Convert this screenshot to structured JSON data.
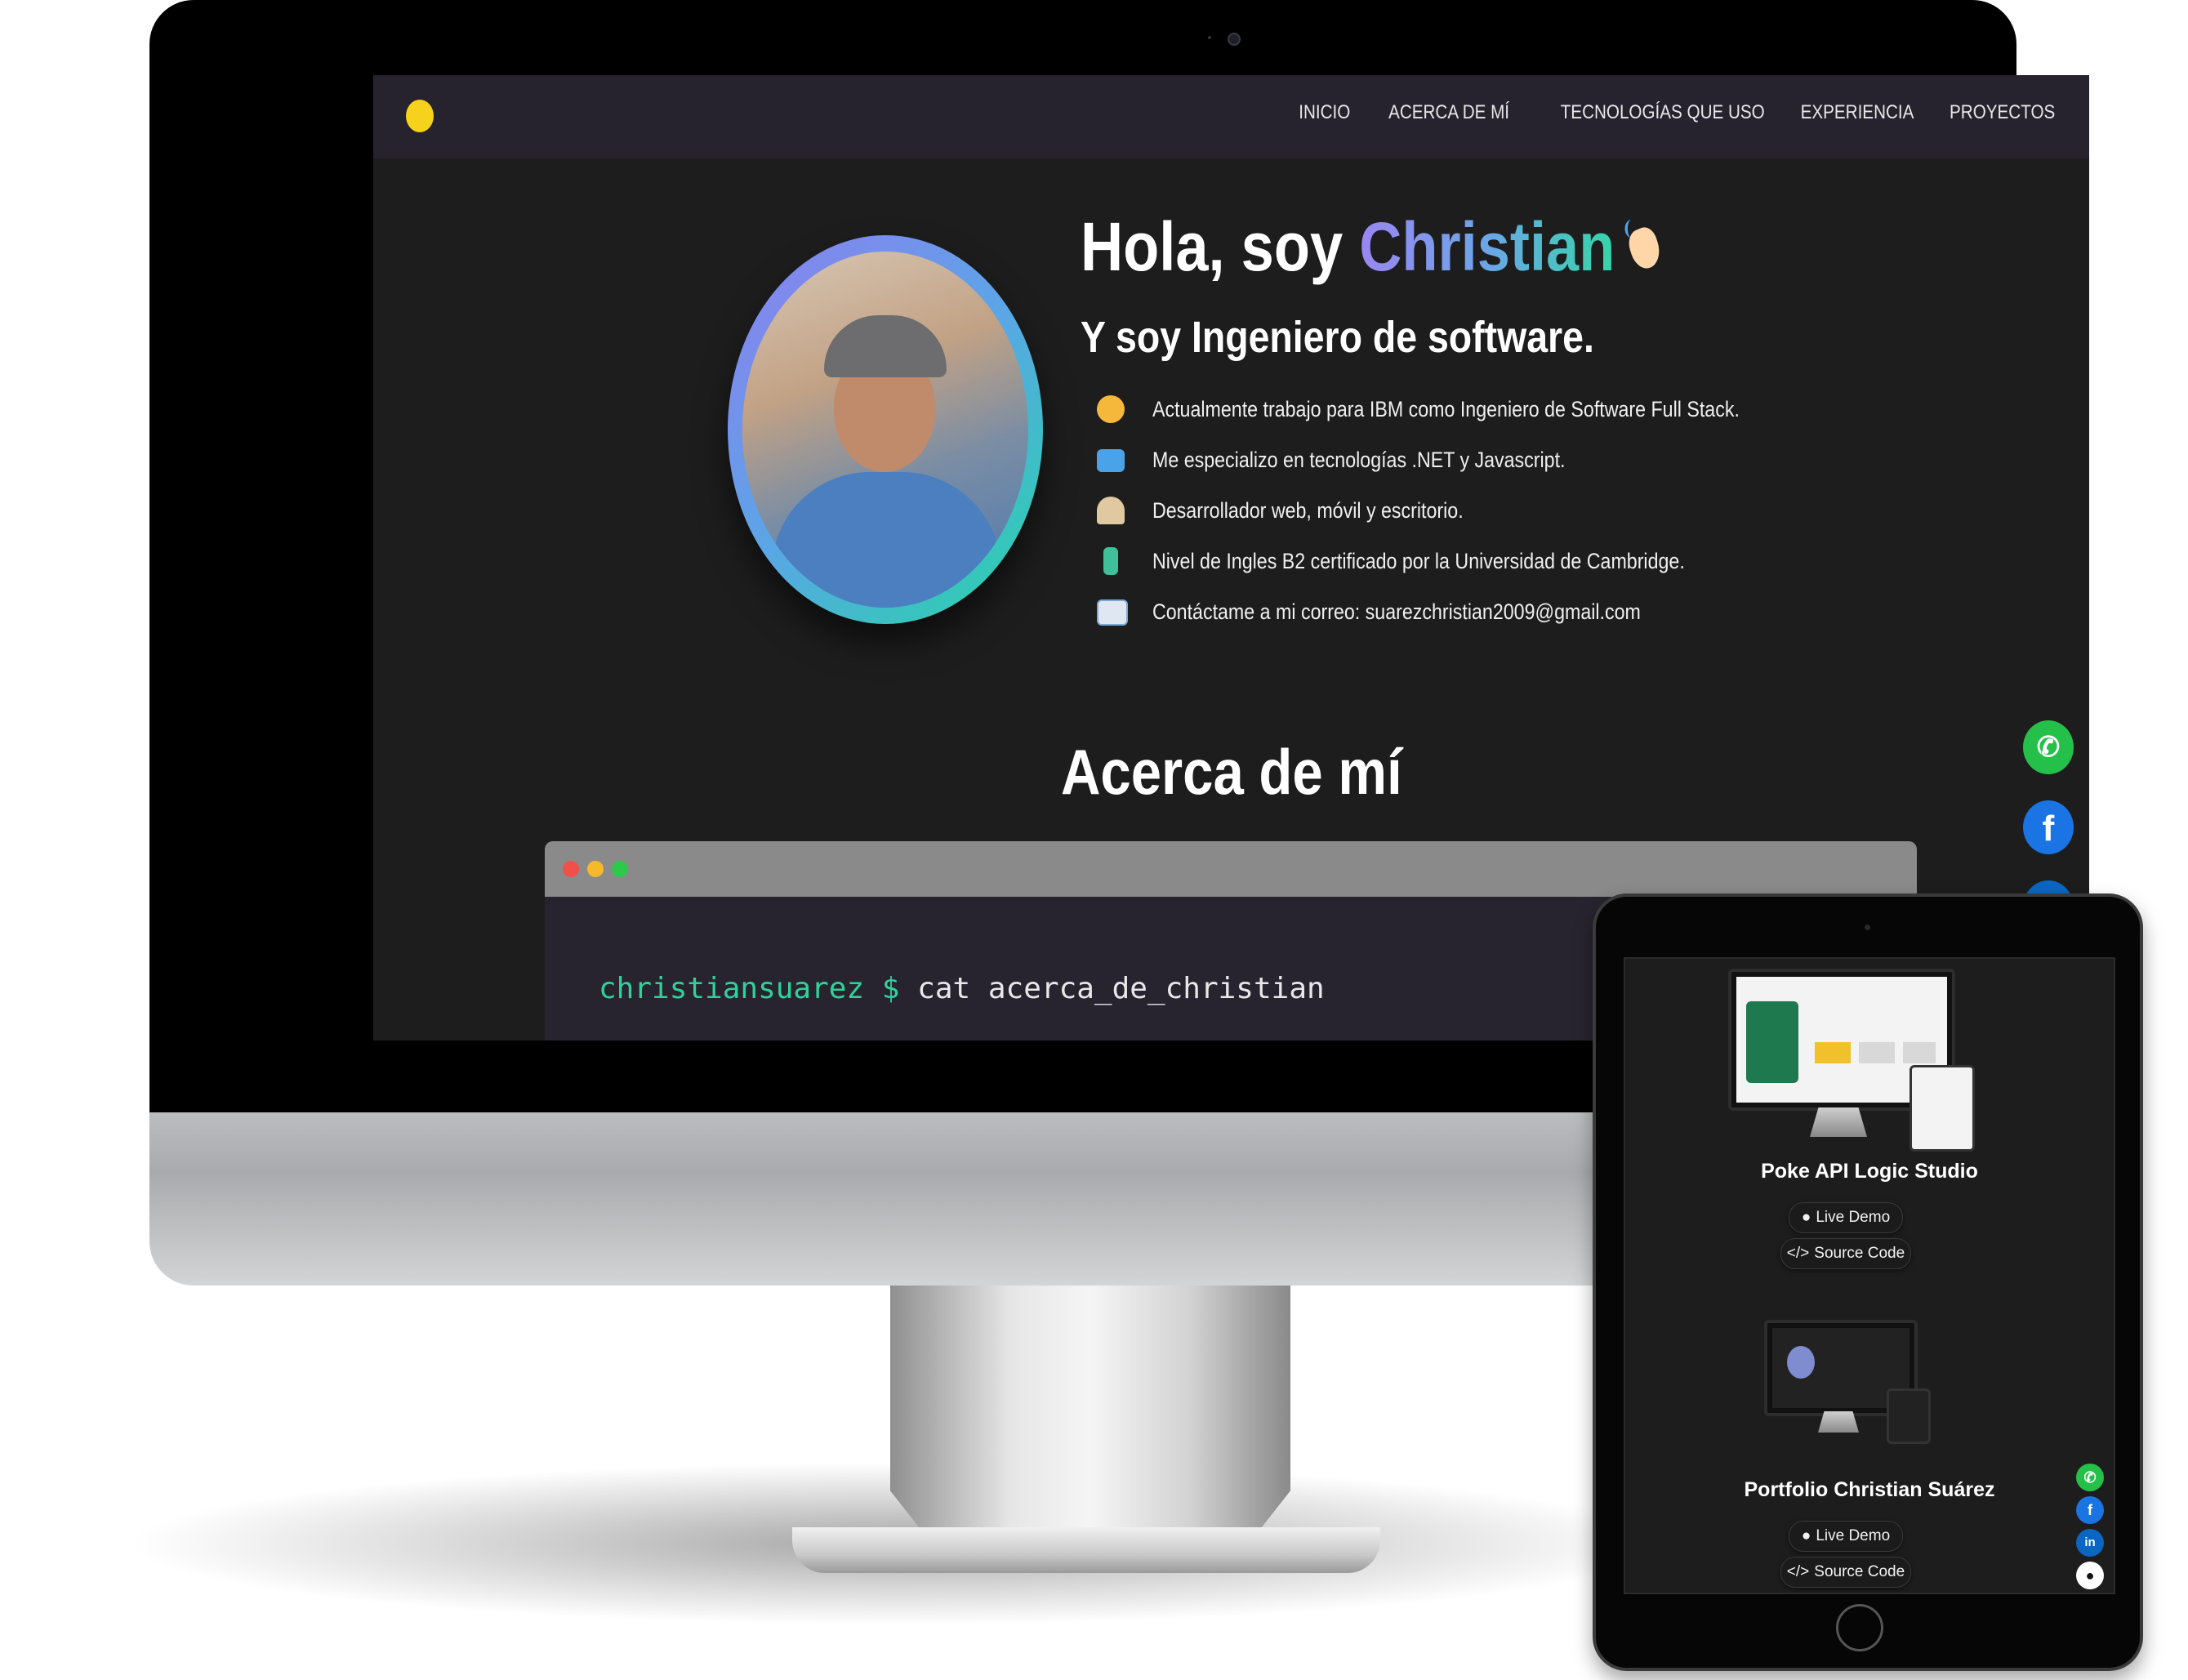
{
  "desktop": {
    "nav": {
      "links": [
        "INICIO",
        "ACERCA DE MÍ",
        "TECNOLOGÍAS QUE USO",
        "EXPERIENCIA",
        "PROYECTOS"
      ]
    },
    "hero": {
      "greeting": "Hola, soy ",
      "name": "Christian",
      "subtitle": "Y soy Ingeniero de software.",
      "bullets": [
        {
          "icon": "nerd-face-icon",
          "text": "Actualmente trabajo para IBM como Ingeniero de Software Full Stack."
        },
        {
          "icon": "laptop-icon",
          "text": "Me especializo en tecnologías .NET y Javascript."
        },
        {
          "icon": "technologist-icon",
          "text": "Desarrollador web, móvil y escritorio."
        },
        {
          "icon": "statue-of-liberty-icon",
          "text": "Nivel de Ingles B2 certificado por la Universidad de Cambridge."
        },
        {
          "icon": "email-icon",
          "text": "Contáctame a mi correo: suarezchristian2009@gmail.com"
        }
      ]
    },
    "about": {
      "title": "Acerca de mí",
      "terminal": {
        "user": "christiansuarez",
        "prompt": "$",
        "command": "cat acerca_de_christian"
      }
    },
    "colors": {
      "nav_bg": "#26232f",
      "page_bg": "#1d1d1d",
      "accent_gradient_start": "#9a86f2",
      "accent_gradient_end": "#34d6a8",
      "terminal_green": "#2fd29a",
      "whatsapp": "#25c04a",
      "facebook": "#1b74e4",
      "linkedin": "#0a66c2"
    }
  },
  "tablet": {
    "projects": [
      {
        "title": "Poke API Logic Studio",
        "demo_label": "Live Demo",
        "source_label": "Source Code"
      },
      {
        "title": "Portfolio Christian Suárez",
        "demo_label": "Live Demo",
        "source_label": "Source Code"
      }
    ],
    "social_icons": [
      "whatsapp-icon",
      "facebook-icon",
      "linkedin-icon",
      "github-icon"
    ]
  }
}
